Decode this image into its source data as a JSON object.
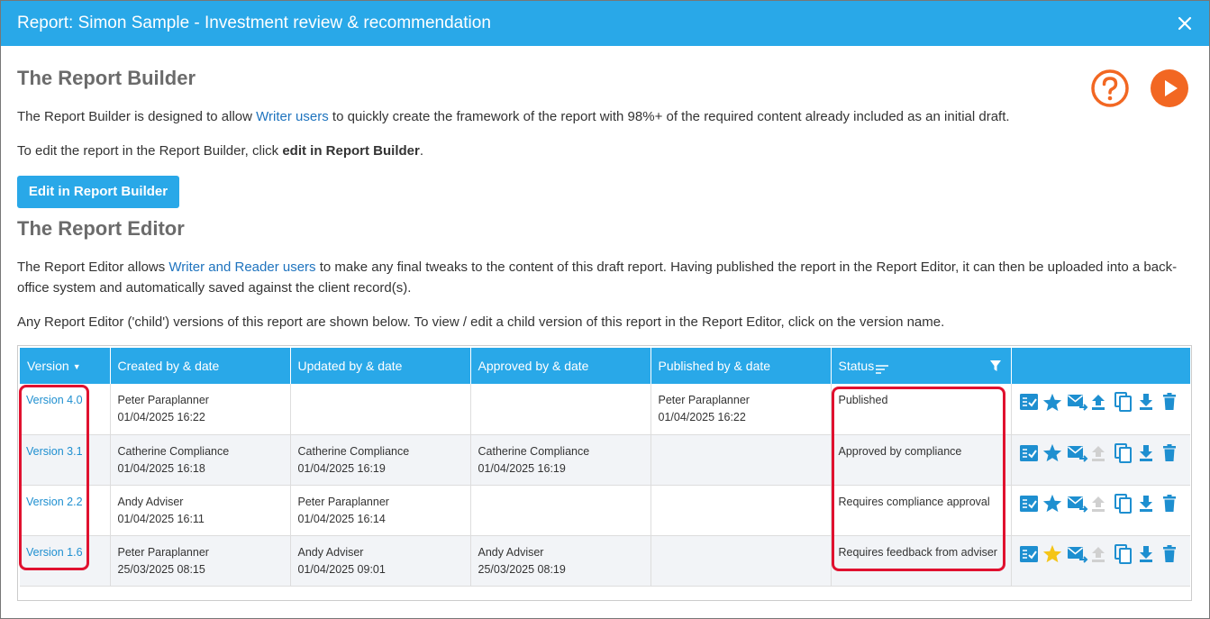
{
  "window": {
    "title": "Report: Simon Sample - Investment review & recommendation"
  },
  "builder": {
    "heading": "The Report Builder",
    "intro_before": "The Report Builder is designed to allow ",
    "intro_link": "Writer users",
    "intro_after": " to quickly create the framework of the report with 98%+ of the required content already included as an initial draft.",
    "edit_before": "To edit the report in the Report Builder, click ",
    "edit_bold": "edit in Report Builder",
    "edit_after": ".",
    "button_label": "Edit in Report Builder"
  },
  "editor": {
    "heading": "The Report Editor",
    "intro_before": "The Report Editor allows ",
    "intro_link": "Writer and Reader users",
    "intro_after": " to make any final tweaks to the content of this draft report. Having published the report in the Report Editor, it can then be uploaded into a back-office system and automatically saved against the client record(s).",
    "versions_note": "Any Report Editor ('child') versions of this report are shown below. To view / edit a child version of this report in the Report Editor, click on the version name."
  },
  "table": {
    "headers": {
      "version": "Version",
      "created": "Created by & date",
      "updated": "Updated by & date",
      "approved": "Approved by & date",
      "published": "Published by & date",
      "status": "Status"
    },
    "rows": [
      {
        "version": "Version 4.0",
        "created_by": "Peter Paraplanner",
        "created_date": "01/04/2025 16:22",
        "updated_by": "",
        "updated_date": "",
        "approved_by": "",
        "approved_date": "",
        "published_by": "Peter Paraplanner",
        "published_date": "01/04/2025 16:22",
        "status": "Published",
        "upload_enabled": true,
        "starred": false
      },
      {
        "version": "Version 3.1",
        "created_by": "Catherine Compliance",
        "created_date": "01/04/2025 16:18",
        "updated_by": "Catherine Compliance",
        "updated_date": "01/04/2025 16:19",
        "approved_by": "Catherine Compliance",
        "approved_date": "01/04/2025 16:19",
        "published_by": "",
        "published_date": "",
        "status": "Approved by compliance",
        "upload_enabled": false,
        "starred": false
      },
      {
        "version": "Version 2.2",
        "created_by": "Andy Adviser",
        "created_date": "01/04/2025 16:11",
        "updated_by": "Peter Paraplanner",
        "updated_date": "01/04/2025 16:14",
        "approved_by": "",
        "approved_date": "",
        "published_by": "",
        "published_date": "",
        "status": "Requires compliance approval",
        "upload_enabled": false,
        "starred": false
      },
      {
        "version": "Version 1.6",
        "created_by": "Peter Paraplanner",
        "created_date": "25/03/2025 08:15",
        "updated_by": "Andy Adviser",
        "updated_date": "01/04/2025 09:01",
        "approved_by": "Andy Adviser",
        "approved_date": "25/03/2025 08:19",
        "published_by": "",
        "published_date": "",
        "status": "Requires feedback from adviser",
        "upload_enabled": false,
        "starred": true
      }
    ]
  },
  "colors": {
    "accent": "#29a8e8",
    "link": "#1e73be",
    "orange": "#f26722",
    "highlight": "#e0112f",
    "star_active": "#f5c518",
    "icon": "#1e8fd0",
    "icon_disabled": "#d0d0d0"
  }
}
